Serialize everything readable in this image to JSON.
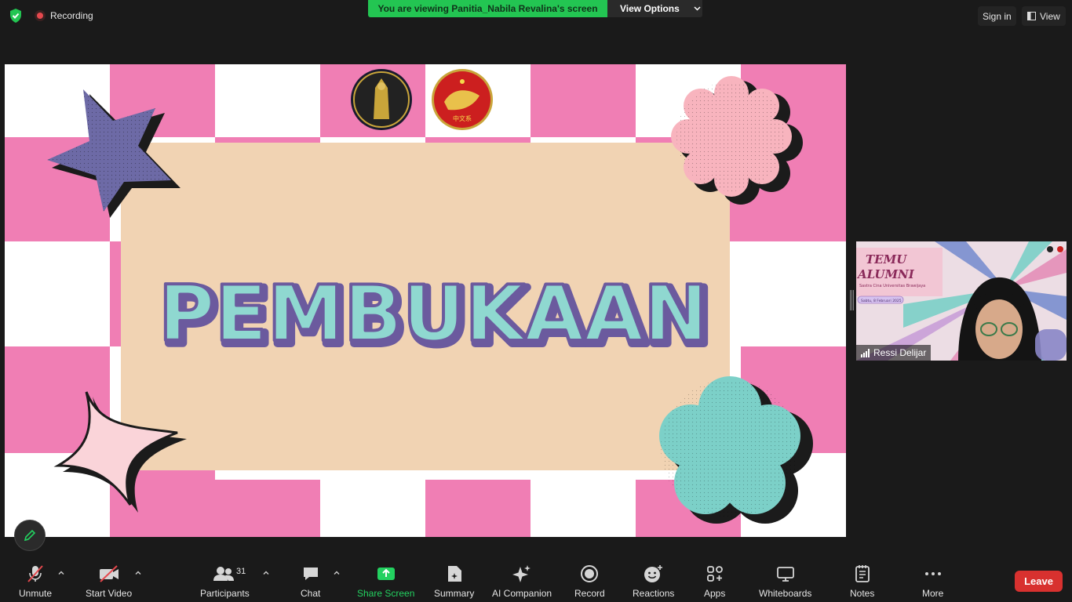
{
  "topbar": {
    "recording_label": "Recording",
    "viewing_banner": "You are viewing Panitia_Nabila Revalina's screen",
    "view_options_label": "View Options",
    "sign_in_label": "Sign in",
    "view_label": "View"
  },
  "slide": {
    "title": "PEMBUKAAN",
    "logo_left_text": "UNIVERSITAS BRAWIJAYA",
    "logo_right_text": "中文系",
    "colors": {
      "pink": "#f07eb4",
      "panel": "#f1d3b3",
      "title_fill": "#8fd8d0",
      "title_stroke": "#6b5a9e",
      "star": "#6d6aa6",
      "flower_pink": "#f8b4be",
      "flower_teal": "#7cd0c8",
      "sparkle": "#fad4d9"
    }
  },
  "participant": {
    "name": "Ressi Delijar",
    "background_text_line1": "TEMU",
    "background_text_line2": "ALUMNI",
    "background_subtitle": "Sastra Cina Universitas Brawijaya",
    "background_date": "Sabtu, 8 Februari 2025"
  },
  "toolbar": {
    "unmute_label": "Unmute",
    "start_video_label": "Start Video",
    "participants_label": "Participants",
    "participants_count": "31",
    "chat_label": "Chat",
    "share_screen_label": "Share Screen",
    "summary_label": "Summary",
    "ai_companion_label": "AI Companion",
    "record_label": "Record",
    "reactions_label": "Reactions",
    "apps_label": "Apps",
    "whiteboards_label": "Whiteboards",
    "notes_label": "Notes",
    "more_label": "More",
    "leave_label": "Leave",
    "accent": "#23d160",
    "leave_color": "#d8312f"
  }
}
